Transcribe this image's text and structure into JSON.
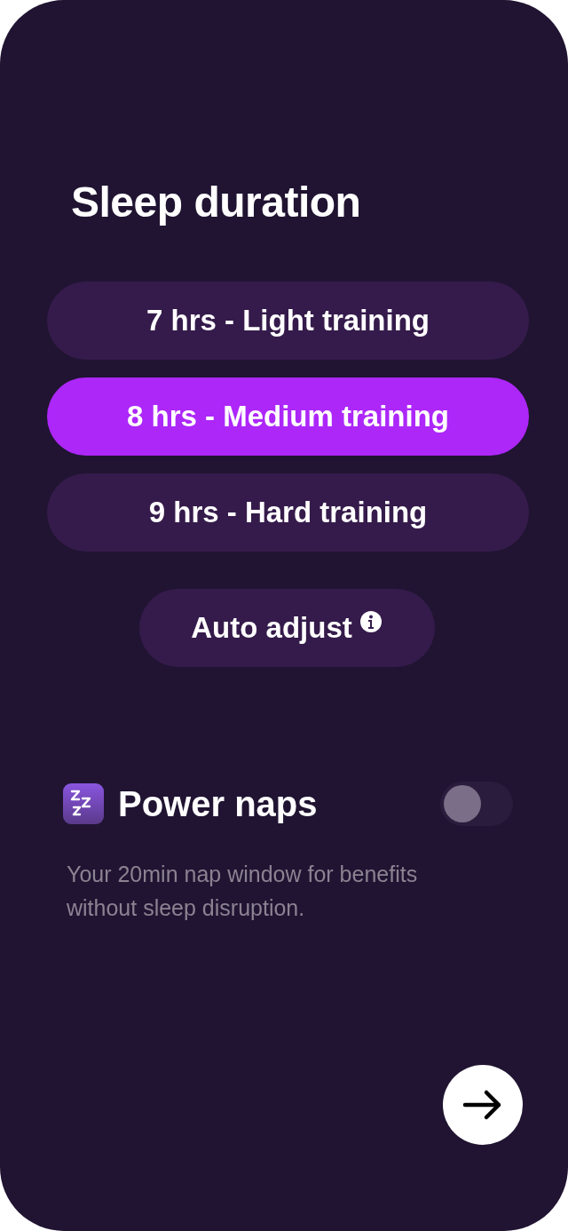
{
  "title": "Sleep duration",
  "options": [
    {
      "label": "7 hrs - Light training",
      "selected": false
    },
    {
      "label": "8 hrs - Medium training",
      "selected": true
    },
    {
      "label": "9 hrs - Hard training",
      "selected": false
    }
  ],
  "auto_adjust": {
    "label": "Auto adjust"
  },
  "power_naps": {
    "title": "Power naps",
    "on": false,
    "description": "Your 20min nap window for benefits without sleep disruption."
  }
}
